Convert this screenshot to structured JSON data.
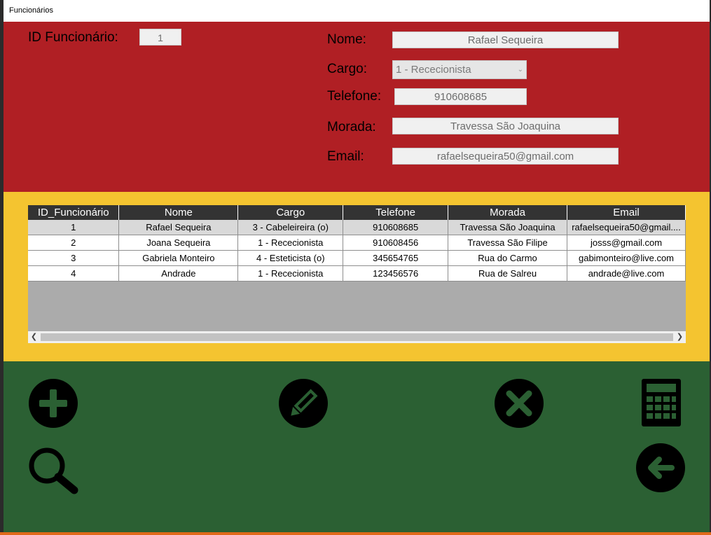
{
  "window": {
    "title": "Funcionários"
  },
  "form": {
    "id_label": "ID Funcionário:",
    "id_value": "1",
    "nome_label": "Nome:",
    "nome_value": "Rafael Sequeira",
    "cargo_label": "Cargo:",
    "cargo_value": "1 - Rececionista",
    "telefone_label": "Telefone:",
    "telefone_value": "910608685",
    "morada_label": "Morada:",
    "morada_value": "Travessa São Joaquina",
    "email_label": "Email:",
    "email_value": "rafaelsequeira50@gmail.com"
  },
  "grid": {
    "columns": [
      "ID_Funcionário",
      "Nome",
      "Cargo",
      "Telefone",
      "Morada",
      "Email"
    ],
    "rows": [
      [
        "1",
        "Rafael Sequeira",
        "3 - Cabeleireira (o)",
        "910608685",
        "Travessa São Joaquina",
        "rafaelsequeira50@gmail...."
      ],
      [
        "2",
        "Joana Sequeira",
        "1 - Rececionista",
        "910608456",
        "Travessa São Filipe",
        "josss@gmail.com"
      ],
      [
        "3",
        "Gabriela Monteiro",
        "4 - Esteticista (o)",
        "345654765",
        "Rua do Carmo",
        "gabimonteiro@live.com"
      ],
      [
        "4",
        "Andrade",
        "1 - Rececionista",
        "123456576",
        "Rua de Salreu",
        "andrade@live.com"
      ]
    ],
    "selected_row": 0
  },
  "actions": {
    "add": "plus-circle-icon",
    "edit": "pencil-circle-icon",
    "delete": "x-circle-icon",
    "calculator": "calculator-icon",
    "search": "search-icon",
    "back": "arrow-left-circle-icon"
  },
  "colors": {
    "top_panel": "#b01f24",
    "grid_panel": "#f4c430",
    "action_panel": "#2b6033",
    "grid_header": "#333333"
  }
}
